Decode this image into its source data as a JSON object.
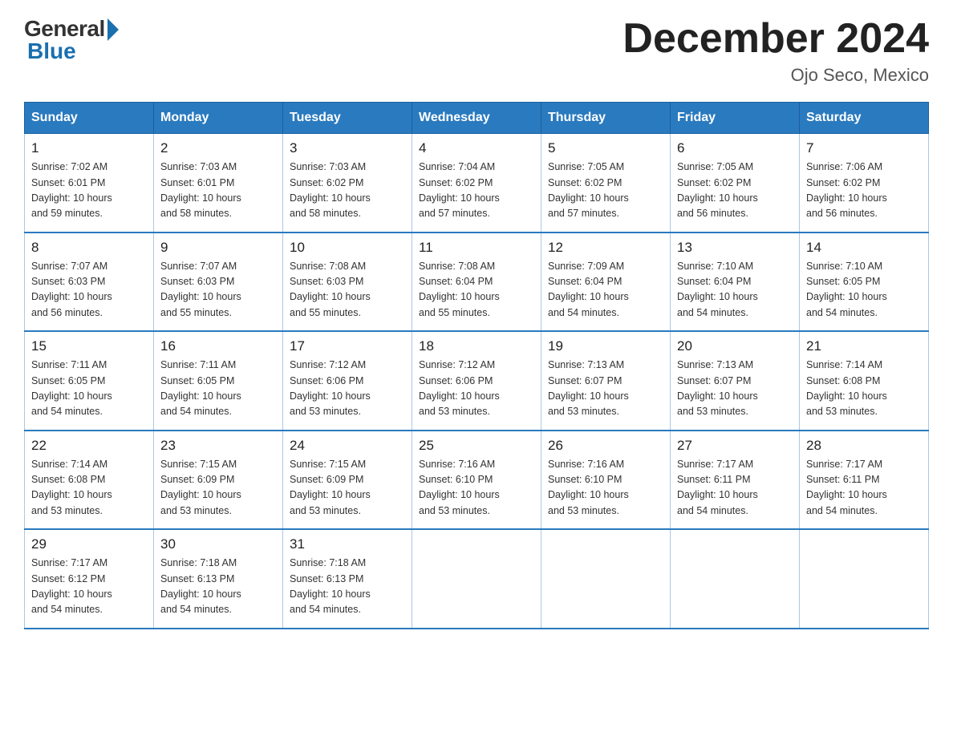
{
  "header": {
    "logo_general": "General",
    "logo_blue": "Blue",
    "month_title": "December 2024",
    "location": "Ojo Seco, Mexico"
  },
  "days_of_week": [
    "Sunday",
    "Monday",
    "Tuesday",
    "Wednesday",
    "Thursday",
    "Friday",
    "Saturday"
  ],
  "weeks": [
    [
      {
        "day": "1",
        "sunrise": "7:02 AM",
        "sunset": "6:01 PM",
        "daylight": "10 hours and 59 minutes."
      },
      {
        "day": "2",
        "sunrise": "7:03 AM",
        "sunset": "6:01 PM",
        "daylight": "10 hours and 58 minutes."
      },
      {
        "day": "3",
        "sunrise": "7:03 AM",
        "sunset": "6:02 PM",
        "daylight": "10 hours and 58 minutes."
      },
      {
        "day": "4",
        "sunrise": "7:04 AM",
        "sunset": "6:02 PM",
        "daylight": "10 hours and 57 minutes."
      },
      {
        "day": "5",
        "sunrise": "7:05 AM",
        "sunset": "6:02 PM",
        "daylight": "10 hours and 57 minutes."
      },
      {
        "day": "6",
        "sunrise": "7:05 AM",
        "sunset": "6:02 PM",
        "daylight": "10 hours and 56 minutes."
      },
      {
        "day": "7",
        "sunrise": "7:06 AM",
        "sunset": "6:02 PM",
        "daylight": "10 hours and 56 minutes."
      }
    ],
    [
      {
        "day": "8",
        "sunrise": "7:07 AM",
        "sunset": "6:03 PM",
        "daylight": "10 hours and 56 minutes."
      },
      {
        "day": "9",
        "sunrise": "7:07 AM",
        "sunset": "6:03 PM",
        "daylight": "10 hours and 55 minutes."
      },
      {
        "day": "10",
        "sunrise": "7:08 AM",
        "sunset": "6:03 PM",
        "daylight": "10 hours and 55 minutes."
      },
      {
        "day": "11",
        "sunrise": "7:08 AM",
        "sunset": "6:04 PM",
        "daylight": "10 hours and 55 minutes."
      },
      {
        "day": "12",
        "sunrise": "7:09 AM",
        "sunset": "6:04 PM",
        "daylight": "10 hours and 54 minutes."
      },
      {
        "day": "13",
        "sunrise": "7:10 AM",
        "sunset": "6:04 PM",
        "daylight": "10 hours and 54 minutes."
      },
      {
        "day": "14",
        "sunrise": "7:10 AM",
        "sunset": "6:05 PM",
        "daylight": "10 hours and 54 minutes."
      }
    ],
    [
      {
        "day": "15",
        "sunrise": "7:11 AM",
        "sunset": "6:05 PM",
        "daylight": "10 hours and 54 minutes."
      },
      {
        "day": "16",
        "sunrise": "7:11 AM",
        "sunset": "6:05 PM",
        "daylight": "10 hours and 54 minutes."
      },
      {
        "day": "17",
        "sunrise": "7:12 AM",
        "sunset": "6:06 PM",
        "daylight": "10 hours and 53 minutes."
      },
      {
        "day": "18",
        "sunrise": "7:12 AM",
        "sunset": "6:06 PM",
        "daylight": "10 hours and 53 minutes."
      },
      {
        "day": "19",
        "sunrise": "7:13 AM",
        "sunset": "6:07 PM",
        "daylight": "10 hours and 53 minutes."
      },
      {
        "day": "20",
        "sunrise": "7:13 AM",
        "sunset": "6:07 PM",
        "daylight": "10 hours and 53 minutes."
      },
      {
        "day": "21",
        "sunrise": "7:14 AM",
        "sunset": "6:08 PM",
        "daylight": "10 hours and 53 minutes."
      }
    ],
    [
      {
        "day": "22",
        "sunrise": "7:14 AM",
        "sunset": "6:08 PM",
        "daylight": "10 hours and 53 minutes."
      },
      {
        "day": "23",
        "sunrise": "7:15 AM",
        "sunset": "6:09 PM",
        "daylight": "10 hours and 53 minutes."
      },
      {
        "day": "24",
        "sunrise": "7:15 AM",
        "sunset": "6:09 PM",
        "daylight": "10 hours and 53 minutes."
      },
      {
        "day": "25",
        "sunrise": "7:16 AM",
        "sunset": "6:10 PM",
        "daylight": "10 hours and 53 minutes."
      },
      {
        "day": "26",
        "sunrise": "7:16 AM",
        "sunset": "6:10 PM",
        "daylight": "10 hours and 53 minutes."
      },
      {
        "day": "27",
        "sunrise": "7:17 AM",
        "sunset": "6:11 PM",
        "daylight": "10 hours and 54 minutes."
      },
      {
        "day": "28",
        "sunrise": "7:17 AM",
        "sunset": "6:11 PM",
        "daylight": "10 hours and 54 minutes."
      }
    ],
    [
      {
        "day": "29",
        "sunrise": "7:17 AM",
        "sunset": "6:12 PM",
        "daylight": "10 hours and 54 minutes."
      },
      {
        "day": "30",
        "sunrise": "7:18 AM",
        "sunset": "6:13 PM",
        "daylight": "10 hours and 54 minutes."
      },
      {
        "day": "31",
        "sunrise": "7:18 AM",
        "sunset": "6:13 PM",
        "daylight": "10 hours and 54 minutes."
      },
      null,
      null,
      null,
      null
    ]
  ],
  "labels": {
    "sunrise": "Sunrise:",
    "sunset": "Sunset:",
    "daylight": "Daylight:"
  }
}
